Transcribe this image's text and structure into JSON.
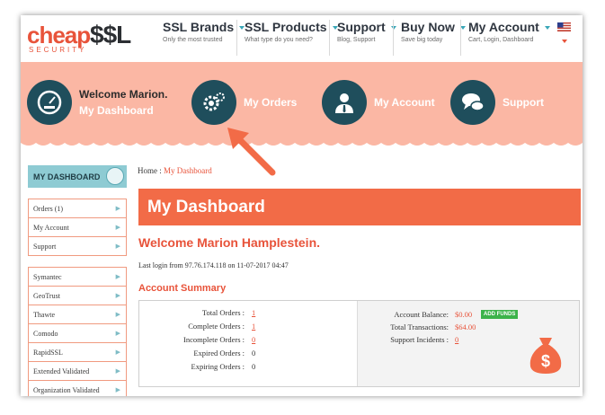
{
  "logo": {
    "cheap": "cheap",
    "ssl": "$$L",
    "security": "SECURITY"
  },
  "nav": [
    {
      "title": "SSL Brands",
      "sub": "Only the most trusted"
    },
    {
      "title": "SSL Products",
      "sub": "What type do you need?"
    },
    {
      "title": "Support",
      "sub": "Blog, Support"
    },
    {
      "title": "Buy Now",
      "sub": "Save big today"
    },
    {
      "title": "My Account",
      "sub": "Cart, Login, Dashboard"
    }
  ],
  "flag_icon": "us-flag-icon",
  "banner": {
    "welcome": "Welcome Marion.",
    "dashboard": "My Dashboard",
    "orders": "My Orders",
    "account": "My Account",
    "support": "Support"
  },
  "sidebar": {
    "header": "MY DASHBOARD",
    "group1": [
      "Orders (1)",
      "My Account",
      "Support"
    ],
    "group2": [
      "Symantec",
      "GeoTrust",
      "Thawte",
      "Comodo",
      "RapidSSL",
      "Extended Validated",
      "Organization Validated"
    ]
  },
  "breadcrumb": {
    "home": "Home",
    "sep": ":",
    "current": "My Dashboard"
  },
  "page_title": "My Dashboard",
  "welcome": "Welcome Marion Hamplestein.",
  "last_login": "Last login from 97.76.174.118 on 11-07-2017 04:47",
  "account_summary_title": "Account Summary",
  "summary_left": [
    {
      "label": "Total Orders :",
      "value": "1",
      "link": true
    },
    {
      "label": "Complete Orders :",
      "value": "1",
      "link": true
    },
    {
      "label": "Incomplete Orders :",
      "value": "0",
      "link": true
    },
    {
      "label": "Expired Orders :",
      "value": "0",
      "link": false
    },
    {
      "label": "Expiring Orders :",
      "value": "0",
      "link": false
    }
  ],
  "summary_right": [
    {
      "label": "Account Balance:",
      "value": "$0.00"
    },
    {
      "label": "Total Transactions:",
      "value": "$64.00"
    },
    {
      "label": "Support Incidents :",
      "value": "0"
    }
  ],
  "add_funds": "ADD FUNDS",
  "colors": {
    "accent": "#f26b47",
    "banner": "#fbb7a4",
    "teal": "#1f4e5c"
  }
}
